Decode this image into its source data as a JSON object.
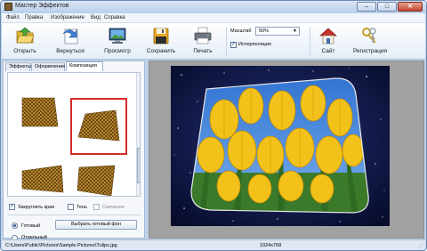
{
  "window": {
    "title": "Мастер Эффектов",
    "buttons": {
      "minimize": "–",
      "maximize": "□",
      "close": "✕"
    }
  },
  "menu": [
    "Файл",
    "Правка",
    "Изображение",
    "Вид",
    "Справка"
  ],
  "toolbar": {
    "open": "Открыть",
    "back": "Вернуться",
    "preview": "Просмотр",
    "save": "Сохранить",
    "print": "Печать",
    "site": "Сайт",
    "register": "Регистрация"
  },
  "zoom": {
    "label": "Масштаб",
    "value": "50%",
    "interpolation_label": "Интерполяция",
    "interpolation_checked": true
  },
  "tabs": [
    "Эффекты",
    "Оформление",
    "Композиция"
  ],
  "active_tab": "Композиция",
  "options": {
    "round_corners": "Закруглить края",
    "round_corners_checked": true,
    "shadow": "Тень",
    "shadow_checked": false,
    "glow": "Свечение",
    "glow_checked": false
  },
  "background": {
    "ready_label": "Готовый",
    "ready_selected": true,
    "choose_button": "Выбрать готовый фон",
    "other_label": "Отдельный"
  },
  "status": {
    "path": "C:\\Users\\Public\\Pictures\\Sample Pictures\\Tulips.jpg",
    "size": "1024x768"
  },
  "icons": {
    "open": "folder-open-icon",
    "back": "undo-arrow-icon",
    "preview": "monitor-icon",
    "save": "floppy-disk-icon",
    "print": "printer-icon",
    "site": "house-icon",
    "register": "keys-icon"
  },
  "colors": {
    "selection": "#d32b2b",
    "space_background": "#0f1a45",
    "tulip_yellow": "#f2c21a"
  }
}
